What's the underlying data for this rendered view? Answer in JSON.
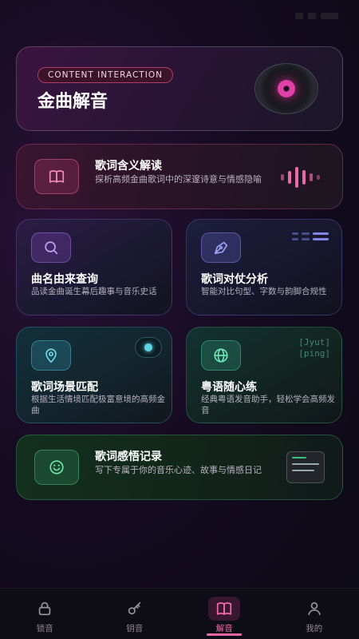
{
  "hero": {
    "badge": "CONTENT INTERACTION",
    "title": "金曲解音",
    "vinyl_icon": "vinyl-record-icon"
  },
  "features": [
    {
      "title": "歌词含义解读",
      "desc": "探析高频金曲歌词中的深邃诗意与情感隐喻",
      "icon": "book-icon",
      "accent": "#e86aa6"
    },
    {
      "title": "曲名由来查询",
      "desc": "品读金曲诞生幕后趣事与音乐史话",
      "icon": "search-icon",
      "accent": "#a070e0"
    },
    {
      "title": "歌词对仗分析",
      "desc": "智能对比句型、字数与韵脚合规性",
      "icon": "pen-nib-icon",
      "accent": "#8088ee"
    },
    {
      "title": "歌词场景匹配",
      "desc": "根据生活情境匹配极富意境的高频金曲",
      "icon": "location-pin-icon",
      "accent": "#5fc8de"
    },
    {
      "title": "粤语随心练",
      "desc": "经典粤语发音助手，轻松学会高频发音",
      "icon": "globe-icon",
      "accent": "#50c8a0",
      "deco_text": [
        "[Jyut]",
        "[ping]"
      ]
    },
    {
      "title": "歌词感悟记录",
      "desc": "写下专属于你的音乐心迹、故事与情感日记",
      "icon": "smile-icon",
      "accent": "#50d08a"
    }
  ],
  "tabs": [
    {
      "label": "锁音",
      "icon": "lock-icon",
      "active": false
    },
    {
      "label": "钥音",
      "icon": "key-icon",
      "active": false
    },
    {
      "label": "解音",
      "icon": "book-icon",
      "active": true
    },
    {
      "label": "我的",
      "icon": "user-icon",
      "active": false
    }
  ]
}
